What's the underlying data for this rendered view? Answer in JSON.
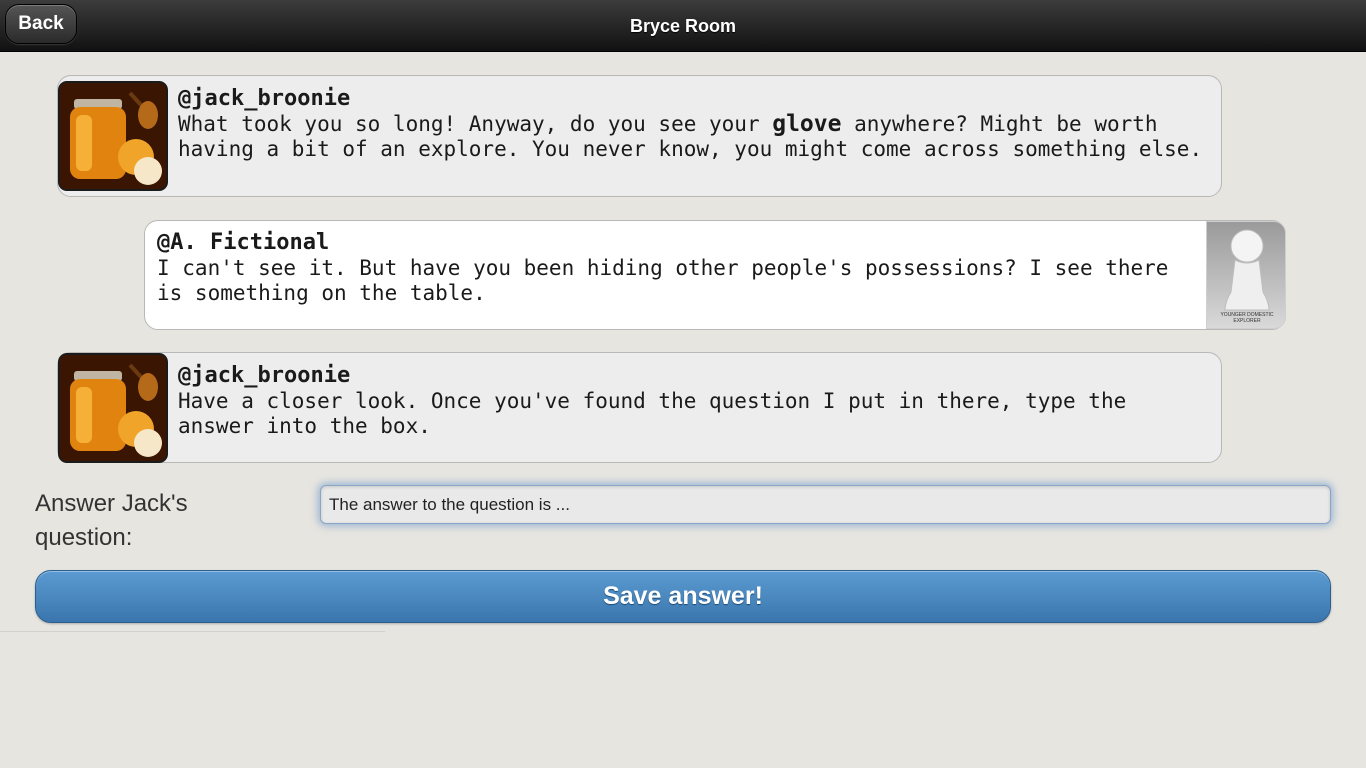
{
  "header": {
    "back_label": "Back",
    "title": "Bryce Room"
  },
  "messages": [
    {
      "author": "@jack_broonie",
      "text_before": "What took you so long! Anyway, do you see your ",
      "bold": "glove",
      "text_after": " anywhere? Might be worth having a bit of an explore. You never know, you might come across something else.",
      "avatar_icon": "honey-jar-avatar"
    },
    {
      "author": "@A. Fictional",
      "text": "I can't see it. But have you been hiding other people's possessions? I see there is something on the table.",
      "avatar_icon": "pawn-avatar",
      "avatar_caption": "YOUNGER DOMESTIC EXPLORER"
    },
    {
      "author": "@jack_broonie",
      "text": "Have a closer look. Once you've found the question I put in there, type the answer into the box.",
      "avatar_icon": "honey-jar-avatar"
    }
  ],
  "form": {
    "label": "Answer Jack's question:",
    "answer_value": "The answer to the question is ...",
    "save_label": "Save answer!"
  },
  "colors": {
    "header": "#1f1f1f",
    "save_button": "#4a87bf",
    "background": "#e7e5e0"
  }
}
